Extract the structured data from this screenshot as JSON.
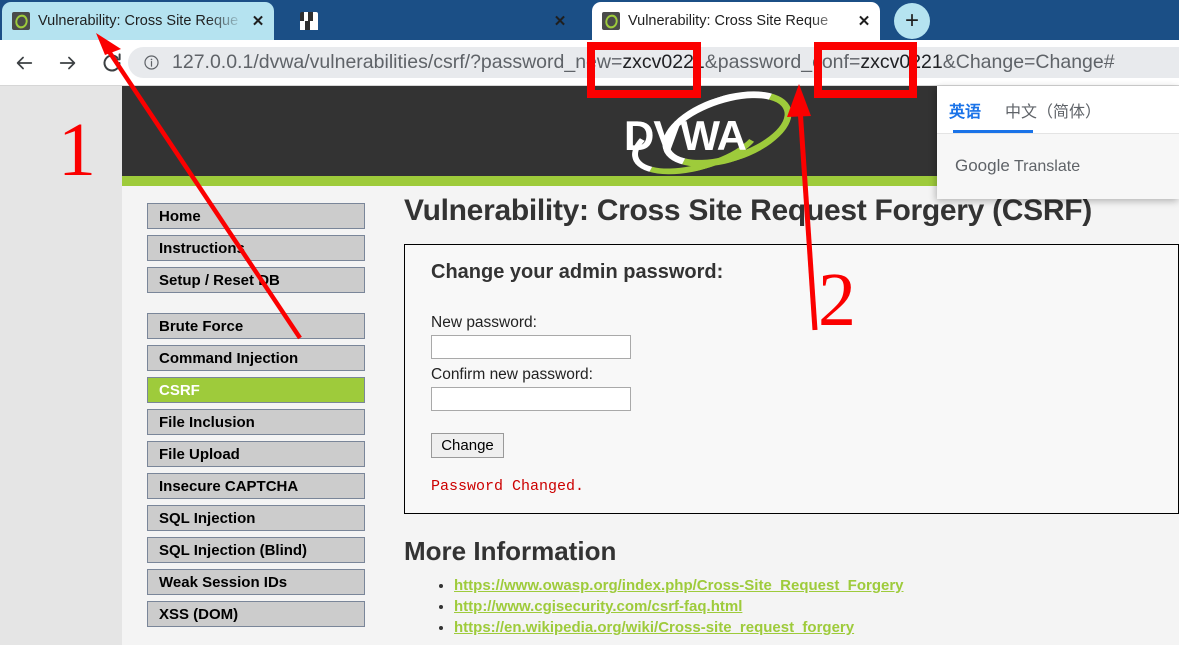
{
  "browser": {
    "tabs": [
      {
        "title": "Vulnerability: Cross Site Reque",
        "favicon": "dvwa-favicon",
        "state": "background-active",
        "close_label": "✕"
      },
      {
        "title": "",
        "favicon": "blurred-favicon",
        "state": "blurred",
        "close_label": "✕"
      },
      {
        "title": "Vulnerability: Cross Site Reque",
        "favicon": "dvwa-favicon",
        "state": "active",
        "close_label": "✕"
      }
    ],
    "new_tab_label": "+",
    "nav": {
      "back": "←",
      "forward": "→",
      "reload": "↻"
    },
    "omnibox": {
      "info_icon": "ⓘ",
      "url_prefix": "127.0.0.1/dvwa/vulnerabilities/csrf/?password_new=",
      "url_value_1": "zxcv0221",
      "url_mid": "&password_conf=",
      "url_value_2": "zxcv0221",
      "url_suffix": "&Change=Change#",
      "full_url": "127.0.0.1/dvwa/vulnerabilities/csrf/?password_new=zxcv0221&password_conf=zxcv0221&Change=Change#"
    }
  },
  "translate_popup": {
    "tabs": [
      {
        "label": "英语",
        "selected": true
      },
      {
        "label": "中文（简体）",
        "selected": false
      }
    ],
    "brand_bold": "Google",
    "brand_rest": " Translate"
  },
  "site": {
    "logo_text": "DVWA",
    "sidebar": {
      "group1": [
        {
          "label": "Home",
          "selected": false
        },
        {
          "label": "Instructions",
          "selected": false
        },
        {
          "label": "Setup / Reset DB",
          "selected": false
        }
      ],
      "group2": [
        {
          "label": "Brute Force",
          "selected": false
        },
        {
          "label": "Command Injection",
          "selected": false
        },
        {
          "label": "CSRF",
          "selected": true
        },
        {
          "label": "File Inclusion",
          "selected": false
        },
        {
          "label": "File Upload",
          "selected": false
        },
        {
          "label": "Insecure CAPTCHA",
          "selected": false
        },
        {
          "label": "SQL Injection",
          "selected": false
        },
        {
          "label": "SQL Injection (Blind)",
          "selected": false
        },
        {
          "label": "Weak Session IDs",
          "selected": false
        },
        {
          "label": "XSS (DOM)",
          "selected": false
        }
      ]
    },
    "main": {
      "page_title": "Vulnerability: Cross Site Request Forgery (CSRF)",
      "form_heading": "Change your admin password:",
      "new_password_label": "New password:",
      "new_password_value": "",
      "confirm_password_label": "Confirm new password:",
      "confirm_password_value": "",
      "change_button": "Change",
      "status_message": "Password Changed.",
      "more_info_title": "More Information",
      "more_info_links": [
        "https://www.owasp.org/index.php/Cross-Site_Request_Forgery",
        "http://www.cgisecurity.com/csrf-faq.html",
        "https://en.wikipedia.org/wiki/Cross-site_request_forgery"
      ]
    }
  },
  "annotations": {
    "number_1": "1",
    "number_2": "2",
    "accent_color": "#fb0000"
  }
}
